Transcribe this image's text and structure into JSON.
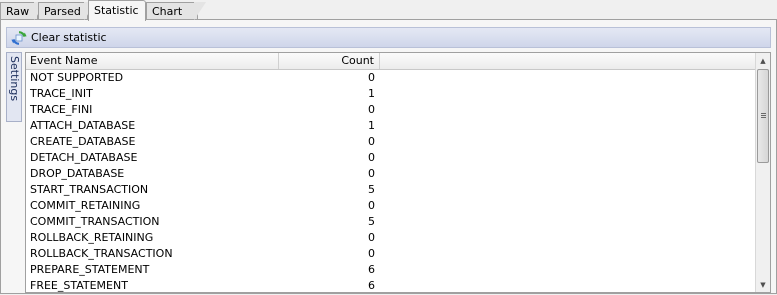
{
  "tabs": [
    {
      "label": "Raw",
      "active": false
    },
    {
      "label": "Parsed",
      "active": false
    },
    {
      "label": "Statistic",
      "active": true
    },
    {
      "label": "Chart",
      "active": false
    }
  ],
  "toolbar": {
    "clear_label": "Clear statistic"
  },
  "side_panel": {
    "settings_label": "Settings"
  },
  "grid": {
    "columns": {
      "name": "Event Name",
      "count": "Count"
    },
    "rows": [
      {
        "name": "NOT SUPPORTED",
        "count": "0"
      },
      {
        "name": "TRACE_INIT",
        "count": "1"
      },
      {
        "name": "TRACE_FINI",
        "count": "0"
      },
      {
        "name": "ATTACH_DATABASE",
        "count": "1"
      },
      {
        "name": "CREATE_DATABASE",
        "count": "0"
      },
      {
        "name": "DETACH_DATABASE",
        "count": "0"
      },
      {
        "name": "DROP_DATABASE",
        "count": "0"
      },
      {
        "name": "START_TRANSACTION",
        "count": "5"
      },
      {
        "name": "COMMIT_RETAINING",
        "count": "0"
      },
      {
        "name": "COMMIT_TRANSACTION",
        "count": "5"
      },
      {
        "name": "ROLLBACK_RETAINING",
        "count": "0"
      },
      {
        "name": "ROLLBACK_TRANSACTION",
        "count": "0"
      },
      {
        "name": "PREPARE_STATEMENT",
        "count": "6"
      },
      {
        "name": "FREE_STATEMENT",
        "count": "6"
      }
    ]
  },
  "icons": {
    "toolbar_icon": "refresh-icon"
  },
  "colors": {
    "toolbar_bg": "#d8ddef",
    "icon_green": "#3aa63a",
    "icon_blue": "#2f6fd0"
  }
}
